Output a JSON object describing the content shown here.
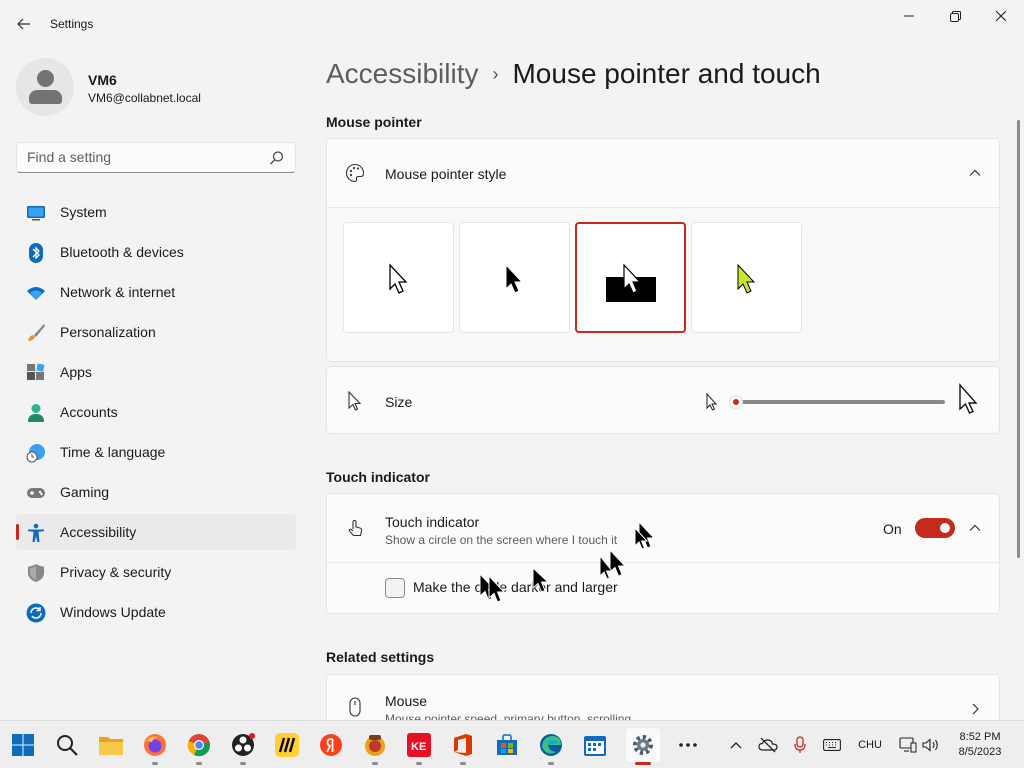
{
  "window": {
    "title": "Settings"
  },
  "profile": {
    "name": "VM6",
    "email": "VM6@collabnet.local"
  },
  "search": {
    "placeholder": "Find a setting"
  },
  "sidebar": {
    "items": [
      {
        "label": "System",
        "icon": "system-icon"
      },
      {
        "label": "Bluetooth & devices",
        "icon": "bluetooth-icon"
      },
      {
        "label": "Network & internet",
        "icon": "wifi-icon"
      },
      {
        "label": "Personalization",
        "icon": "brush-icon"
      },
      {
        "label": "Apps",
        "icon": "apps-icon"
      },
      {
        "label": "Accounts",
        "icon": "accounts-icon"
      },
      {
        "label": "Time & language",
        "icon": "globe-clock-icon"
      },
      {
        "label": "Gaming",
        "icon": "gamepad-icon"
      },
      {
        "label": "Accessibility",
        "icon": "accessibility-icon",
        "active": true
      },
      {
        "label": "Privacy & security",
        "icon": "shield-icon"
      },
      {
        "label": "Windows Update",
        "icon": "update-icon"
      }
    ]
  },
  "breadcrumb": {
    "parent": "Accessibility",
    "separator": "›",
    "current": "Mouse pointer and touch"
  },
  "mouse_pointer": {
    "section_title": "Mouse pointer",
    "style_label": "Mouse pointer style",
    "styles": [
      {
        "name": "white",
        "selected": false
      },
      {
        "name": "black",
        "selected": false
      },
      {
        "name": "inverted",
        "selected": true
      },
      {
        "name": "custom",
        "selected": false,
        "color": "#c8e62a"
      }
    ],
    "size_label": "Size",
    "size_value": 0
  },
  "touch": {
    "section_title": "Touch indicator",
    "label": "Touch indicator",
    "description": "Show a circle on the screen where I touch it",
    "toggle_state": "On",
    "checkbox_label": "Make the circle darker and larger",
    "checkbox_checked": false
  },
  "related": {
    "section_title": "Related settings",
    "mouse_label": "Mouse",
    "mouse_description": "Mouse pointer speed, primary button, scrolling"
  },
  "taskbar": {
    "apps": [
      "start-icon",
      "search-icon",
      "file-explorer-icon",
      "firefox-icon",
      "chrome-icon",
      "obs-icon",
      "miro-icon",
      "yandex-icon",
      "game-icon",
      "kaspersky-icon",
      "office-icon",
      "store-icon",
      "edge-icon",
      "calendar-icon",
      "settings-icon",
      "more-icon"
    ],
    "language": "CHU",
    "time": "8:52 PM",
    "date": "8/5/2023"
  },
  "colors": {
    "accent": "#c42b1c",
    "custom_pointer": "#c8e62a"
  }
}
